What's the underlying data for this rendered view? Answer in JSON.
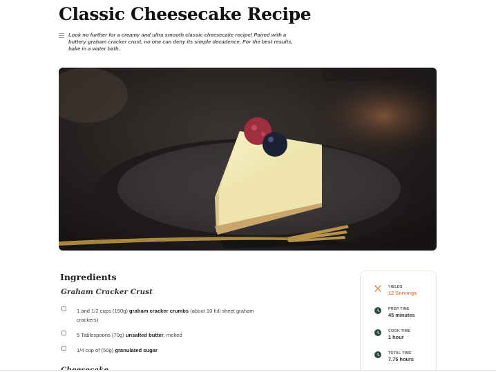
{
  "recipe": {
    "title": "Classic Cheesecake Recipe",
    "intro": "Look no further for a creamy and ultra smooth classic cheesecake recipe! Paired with a buttery graham cracker crust, no one can deny its simple decadence. For the best results, bake in a water bath.",
    "hero_image": "cheesecake-slice-photo"
  },
  "ingredients": {
    "heading": "Ingredients",
    "groups": [
      {
        "title": "Graham Cracker Crust",
        "items": [
          {
            "amount": "1 and 1/2 cups (150g)",
            "name": "graham cracker crumbs",
            "note": "(about 10 full sheet graham crackers)"
          },
          {
            "amount": "5 Tablespoons (70g)",
            "name": "unsalted butter",
            "note": ", melted"
          },
          {
            "amount": "1/4 cup of (50g)",
            "name": "granulated sugar",
            "note": ""
          }
        ]
      },
      {
        "title": "Cheesecake",
        "items": []
      }
    ]
  },
  "meta": [
    {
      "icon": "utensils-icon",
      "label": "YIELDS",
      "value": "12 Servings"
    },
    {
      "icon": "clock-icon",
      "label": "PREP TIME",
      "value": "45 minutes"
    },
    {
      "icon": "clock-icon",
      "label": "COOK TIME",
      "value": "1 hour"
    },
    {
      "icon": "clock-icon",
      "label": "TOTAL TIME",
      "value": "7.75 hours"
    }
  ],
  "colors": {
    "accent": "#e0874a",
    "icon_dark": "#2f4a3e",
    "title": "#111111"
  }
}
